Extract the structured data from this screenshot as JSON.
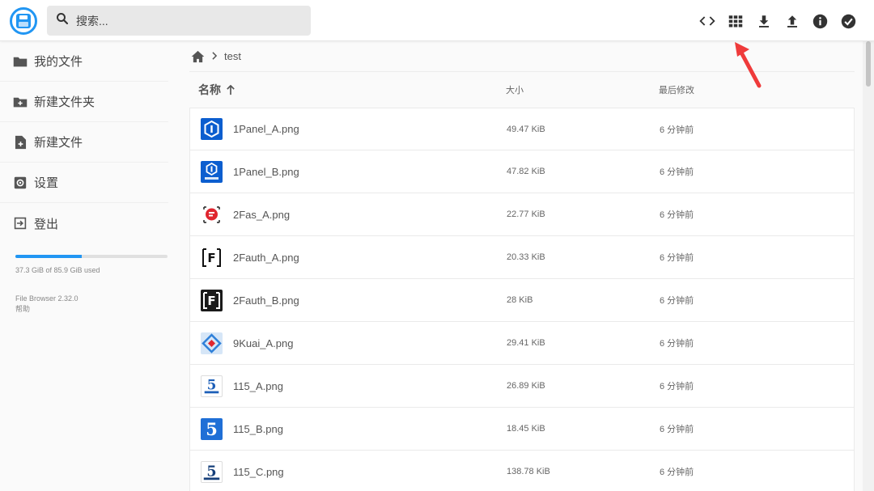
{
  "header": {
    "search_placeholder": "搜索...",
    "toolbar": [
      "code-view-icon",
      "grid-view-icon",
      "download-icon",
      "upload-icon",
      "info-icon",
      "select-all-icon"
    ]
  },
  "sidebar": {
    "items": [
      {
        "label": "我的文件",
        "icon": "folder-icon"
      },
      {
        "label": "新建文件夹",
        "icon": "new-folder-icon"
      },
      {
        "label": "新建文件",
        "icon": "new-file-icon"
      },
      {
        "label": "设置",
        "icon": "settings-icon"
      },
      {
        "label": "登出",
        "icon": "logout-icon"
      }
    ],
    "storage_text": "37.3 GiB of 85.9 GiB used",
    "storage_fraction": 0.434,
    "version": "File Browser 2.32.0",
    "help": "帮助"
  },
  "breadcrumb": {
    "folder": "test"
  },
  "columns": {
    "name": "名称",
    "size": "大小",
    "modified": "最后修改"
  },
  "files": [
    {
      "name": "1Panel_A.png",
      "size": "49.47 KiB",
      "modified": "6 分钟前"
    },
    {
      "name": "1Panel_B.png",
      "size": "47.82 KiB",
      "modified": "6 分钟前"
    },
    {
      "name": "2Fas_A.png",
      "size": "22.77 KiB",
      "modified": "6 分钟前"
    },
    {
      "name": "2Fauth_A.png",
      "size": "20.33 KiB",
      "modified": "6 分钟前"
    },
    {
      "name": "2Fauth_B.png",
      "size": "28 KiB",
      "modified": "6 分钟前"
    },
    {
      "name": "9Kuai_A.png",
      "size": "29.41 KiB",
      "modified": "6 分钟前"
    },
    {
      "name": "115_A.png",
      "size": "26.89 KiB",
      "modified": "6 分钟前"
    },
    {
      "name": "115_B.png",
      "size": "18.45 KiB",
      "modified": "6 分钟前"
    },
    {
      "name": "115_C.png",
      "size": "138.78 KiB",
      "modified": "6 分钟前"
    }
  ],
  "colors": {
    "accent": "#2196f3",
    "arrow": "#ef3b3b"
  }
}
